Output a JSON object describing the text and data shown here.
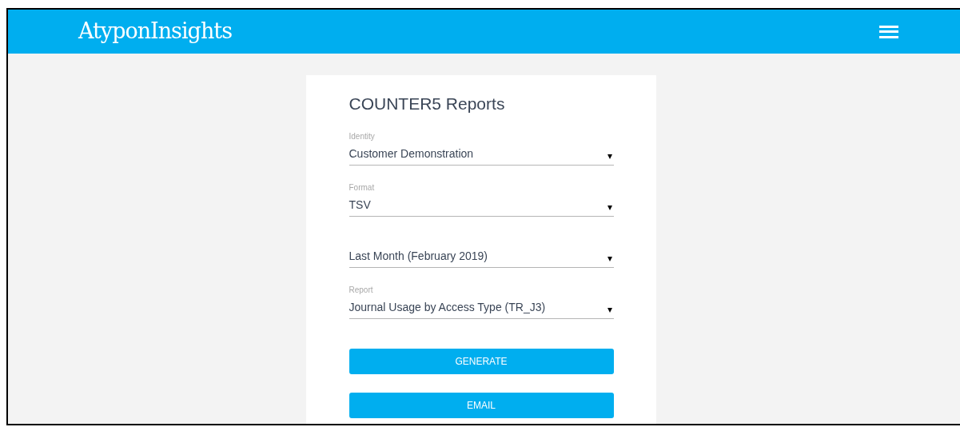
{
  "header": {
    "logo": "Atypon**Insights**"
  },
  "card": {
    "title": "COUNTER5 Reports",
    "fields": [
      {
        "label": "Identity",
        "value": "Customer Demonstration",
        "caret": "▾"
      },
      {
        "label": "Format",
        "value": "TSV",
        "caret": "▾"
      },
      {
        "value": "Last Month (February 2019)",
        "caret": "▾"
      },
      {
        "label": "Report",
        "value": "Journal Usage by Access Type (TR_J3)",
        "caret": "▾"
      }
    ],
    "buttons": [
      "GENERATE",
      "EMAIL"
    ]
  }
}
